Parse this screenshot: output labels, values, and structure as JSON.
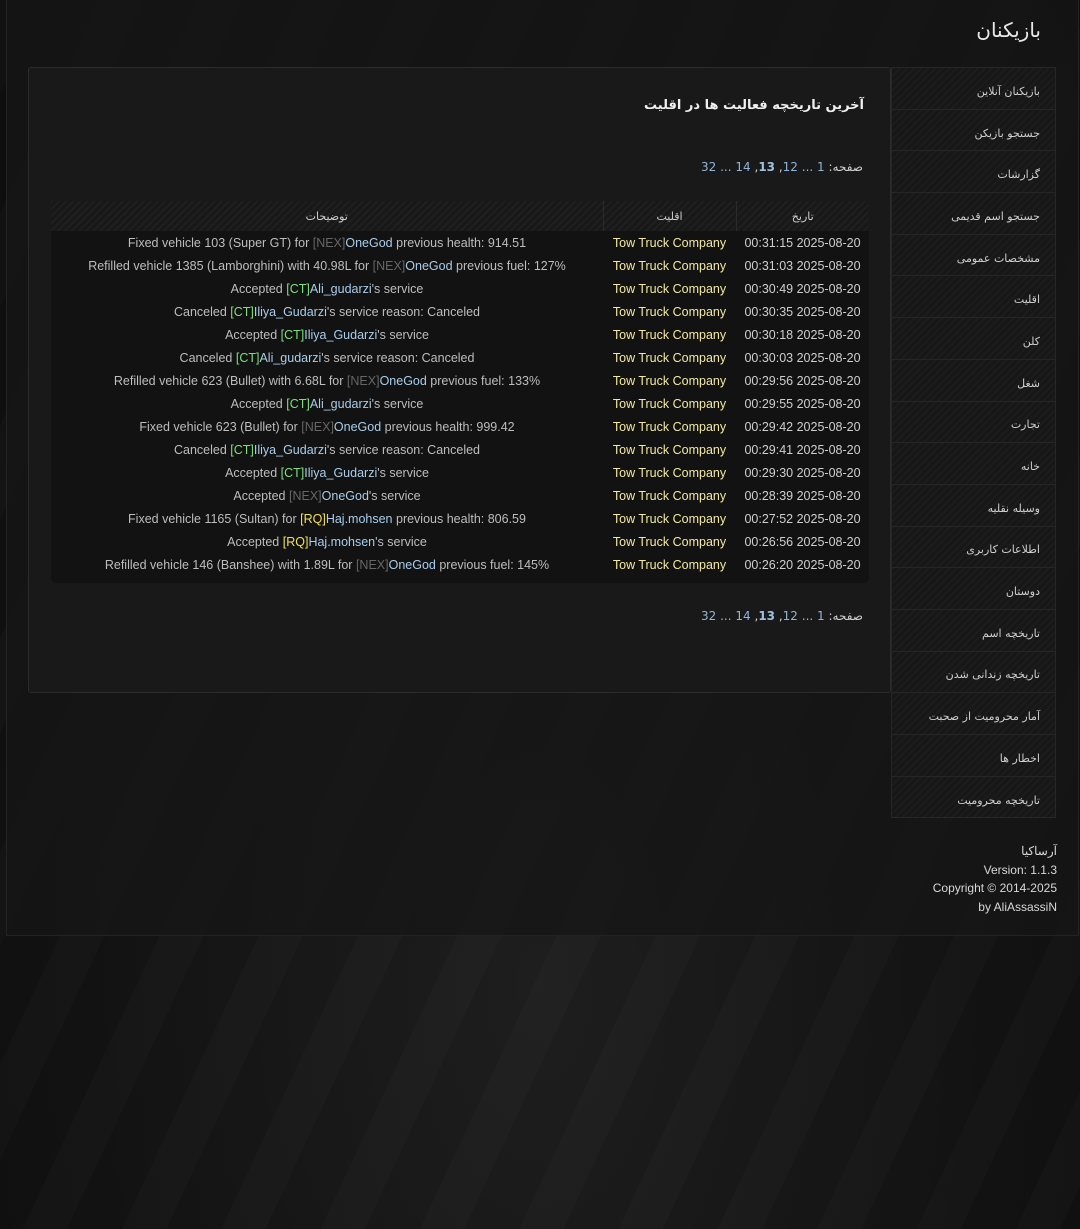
{
  "header": {
    "title": "بازیکنان"
  },
  "sidebar": {
    "items": [
      {
        "label": "بازیکنان آنلاین"
      },
      {
        "label": "جستجو بازیکن"
      },
      {
        "label": "گزارشات"
      },
      {
        "label": "جستجو اسم قدیمی"
      },
      {
        "label": "مشخصات عمومی"
      },
      {
        "label": "اقلیت"
      },
      {
        "label": "کلن"
      },
      {
        "label": "شغل"
      },
      {
        "label": "تجارت"
      },
      {
        "label": "خانه"
      },
      {
        "label": "وسیله نقلیه"
      },
      {
        "label": "اطلاعات کاربری"
      },
      {
        "label": "دوستان"
      },
      {
        "label": "تاریخچه اسم"
      },
      {
        "label": "تاریخچه زندانی شدن"
      },
      {
        "label": "آمار محرومیت از صحبت"
      },
      {
        "label": "اخطار ها"
      },
      {
        "label": "تاریخچه محرومیت"
      }
    ]
  },
  "main": {
    "title": "آخرین تاریخچه فعالیت ها در اقلیت",
    "pagination": {
      "label": "صفحه:",
      "first": "1",
      "ellipsis": "...",
      "prev": "12",
      "current": "13",
      "next": "14",
      "last": "32"
    },
    "table": {
      "headers": {
        "date": "تاریخ",
        "org": "اقلیت",
        "desc": "توضیحات"
      },
      "rows": [
        {
          "date": "2025-08-20 00:31:15",
          "org": "Tow Truck Company",
          "desc": [
            {
              "t": "Fixed vehicle 103 (Super GT) for "
            },
            {
              "t": "[NEX]",
              "c": "nex"
            },
            {
              "t": "OneGod",
              "c": "player"
            },
            {
              "t": " previous health: 914.51"
            }
          ]
        },
        {
          "date": "2025-08-20 00:31:03",
          "org": "Tow Truck Company",
          "desc": [
            {
              "t": "Refilled vehicle 1385 (Lamborghini) with 40.98L for "
            },
            {
              "t": "[NEX]",
              "c": "nex"
            },
            {
              "t": "OneGod",
              "c": "player"
            },
            {
              "t": " previous fuel: 127%"
            }
          ]
        },
        {
          "date": "2025-08-20 00:30:49",
          "org": "Tow Truck Company",
          "desc": [
            {
              "t": "Accepted "
            },
            {
              "t": "[CT]",
              "c": "ct"
            },
            {
              "t": "Ali_gudarzi",
              "c": "player"
            },
            {
              "t": "'s service"
            }
          ]
        },
        {
          "date": "2025-08-20 00:30:35",
          "org": "Tow Truck Company",
          "desc": [
            {
              "t": "Canceled "
            },
            {
              "t": "[CT]",
              "c": "ct"
            },
            {
              "t": "Iliya_Gudarzi",
              "c": "player"
            },
            {
              "t": "'s service reason: Canceled"
            }
          ]
        },
        {
          "date": "2025-08-20 00:30:18",
          "org": "Tow Truck Company",
          "desc": [
            {
              "t": "Accepted "
            },
            {
              "t": "[CT]",
              "c": "ct"
            },
            {
              "t": "Iliya_Gudarzi",
              "c": "player"
            },
            {
              "t": "'s service"
            }
          ]
        },
        {
          "date": "2025-08-20 00:30:03",
          "org": "Tow Truck Company",
          "desc": [
            {
              "t": "Canceled "
            },
            {
              "t": "[CT]",
              "c": "ct"
            },
            {
              "t": "Ali_gudarzi",
              "c": "player"
            },
            {
              "t": "'s service reason: Canceled"
            }
          ]
        },
        {
          "date": "2025-08-20 00:29:56",
          "org": "Tow Truck Company",
          "desc": [
            {
              "t": "Refilled vehicle 623 (Bullet) with 6.68L for "
            },
            {
              "t": "[NEX]",
              "c": "nex"
            },
            {
              "t": "OneGod",
              "c": "player"
            },
            {
              "t": " previous fuel: 133%"
            }
          ]
        },
        {
          "date": "2025-08-20 00:29:55",
          "org": "Tow Truck Company",
          "desc": [
            {
              "t": "Accepted "
            },
            {
              "t": "[CT]",
              "c": "ct"
            },
            {
              "t": "Ali_gudarzi",
              "c": "player"
            },
            {
              "t": "'s service"
            }
          ]
        },
        {
          "date": "2025-08-20 00:29:42",
          "org": "Tow Truck Company",
          "desc": [
            {
              "t": "Fixed vehicle 623 (Bullet) for "
            },
            {
              "t": "[NEX]",
              "c": "nex"
            },
            {
              "t": "OneGod",
              "c": "player"
            },
            {
              "t": " previous health: 999.42"
            }
          ]
        },
        {
          "date": "2025-08-20 00:29:41",
          "org": "Tow Truck Company",
          "desc": [
            {
              "t": "Canceled "
            },
            {
              "t": "[CT]",
              "c": "ct"
            },
            {
              "t": "Iliya_Gudarzi",
              "c": "player"
            },
            {
              "t": "'s service reason: Canceled"
            }
          ]
        },
        {
          "date": "2025-08-20 00:29:30",
          "org": "Tow Truck Company",
          "desc": [
            {
              "t": "Accepted "
            },
            {
              "t": "[CT]",
              "c": "ct"
            },
            {
              "t": "Iliya_Gudarzi",
              "c": "player"
            },
            {
              "t": "'s service"
            }
          ]
        },
        {
          "date": "2025-08-20 00:28:39",
          "org": "Tow Truck Company",
          "desc": [
            {
              "t": "Accepted "
            },
            {
              "t": "[NEX]",
              "c": "nex"
            },
            {
              "t": "OneGod",
              "c": "player"
            },
            {
              "t": "'s service"
            }
          ]
        },
        {
          "date": "2025-08-20 00:27:52",
          "org": "Tow Truck Company",
          "desc": [
            {
              "t": "Fixed vehicle 1165 (Sultan) for "
            },
            {
              "t": "[RQ]",
              "c": "rq"
            },
            {
              "t": "Haj.mohsen",
              "c": "player"
            },
            {
              "t": " previous health: 806.59"
            }
          ]
        },
        {
          "date": "2025-08-20 00:26:56",
          "org": "Tow Truck Company",
          "desc": [
            {
              "t": "Accepted "
            },
            {
              "t": "[RQ]",
              "c": "rq"
            },
            {
              "t": "Haj.mohsen",
              "c": "player"
            },
            {
              "t": "'s service"
            }
          ]
        },
        {
          "date": "2025-08-20 00:26:20",
          "org": "Tow Truck Company",
          "desc": [
            {
              "t": "Refilled vehicle 146 (Banshee) with 1.89L for "
            },
            {
              "t": "[NEX]",
              "c": "nex"
            },
            {
              "t": "OneGod",
              "c": "player"
            },
            {
              "t": " previous fuel: 145%"
            }
          ]
        }
      ]
    }
  },
  "footer": {
    "name": "آرساکیا",
    "version": "Version: 1.1.3",
    "copyright": "Copyright © 2014-2025",
    "author": "by AliAssassiN"
  },
  "colors": {
    "org_text": "#f3e9a0",
    "player_text": "#a9cdea",
    "tag_ct": "#7be07b",
    "tag_rq": "#f3e24f",
    "tag_nex": "#666666",
    "link": "#8fb5d8"
  }
}
